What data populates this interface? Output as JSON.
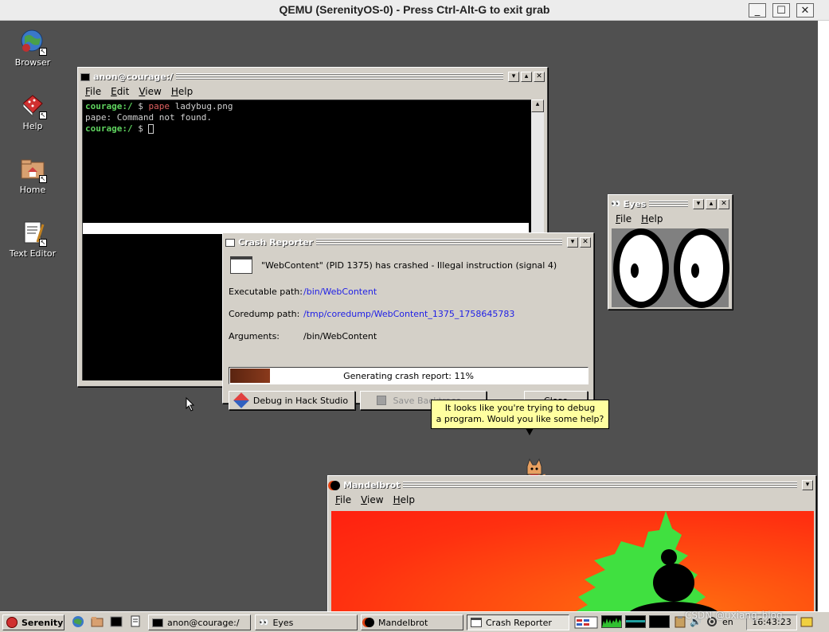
{
  "qemu": {
    "title": "QEMU (SerenityOS-0) - Press Ctrl-Alt-G to exit grab",
    "minimize_glyph": "_",
    "maximize_glyph": "☐",
    "close_glyph": "✕"
  },
  "desktop_icons": [
    {
      "label": "Browser",
      "icon": "globe-icon"
    },
    {
      "label": "Help",
      "icon": "help-book-icon"
    },
    {
      "label": "Home",
      "icon": "home-folder-icon"
    },
    {
      "label": "Text Editor",
      "icon": "text-editor-icon"
    }
  ],
  "terminal": {
    "title": "anon@courage:/",
    "menu": [
      "File",
      "Edit",
      "View",
      "Help"
    ],
    "lines": [
      {
        "prompt": "courage:/",
        "dollar": " $ ",
        "cmd": "pape",
        "rest": " ladybug.png"
      },
      {
        "text": "pape: Command not found."
      },
      {
        "prompt": "courage:/",
        "dollar": " $ "
      }
    ]
  },
  "crash_reporter": {
    "title": "Crash Reporter",
    "headline": "\"WebContent\" (PID 1375) has crashed - Illegal instruction (signal 4)",
    "executable_label": "Executable path:",
    "executable_value": "/bin/WebContent",
    "coredump_label": "Coredump path:",
    "coredump_value": "/tmp/coredump/WebContent_1375_1758645783",
    "arguments_label": "Arguments:",
    "arguments_value": "/bin/WebContent",
    "progress_text": "Generating crash report: 11%",
    "progress_fraction": 0.11,
    "debug_button": "Debug in Hack Studio",
    "save_button": "Save Backtrace...",
    "close_button": "Close"
  },
  "eyes": {
    "title": "Eyes",
    "menu": [
      "File",
      "Help"
    ]
  },
  "assistant": {
    "line1": "It looks like you're trying to debug",
    "line2": "a program. Would you like some help?"
  },
  "mandelbrot": {
    "title": "Mandelbrot",
    "menu": [
      "File",
      "View",
      "Help"
    ]
  },
  "taskbar": {
    "start_label": "Serenity",
    "quick_launch": [
      "browser-icon",
      "file-manager-icon",
      "terminal-icon",
      "text-editor-icon"
    ],
    "windows": [
      {
        "label": "anon@courage:/",
        "icon": "terminal-icon"
      },
      {
        "label": "Eyes",
        "icon": "eyes-icon"
      },
      {
        "label": "Mandelbrot",
        "icon": "mandelbrot-icon"
      },
      {
        "label": "Crash Reporter",
        "icon": "crash-reporter-icon"
      }
    ],
    "keymap": "en",
    "clock": "16:43:23",
    "watermark": "CSDN @uxiang_blog"
  },
  "colors": {
    "desktop": "#505050",
    "terminal_prompt": "#5fd35f",
    "link": "#1e1ee6",
    "progress_fill": "#6a2a14",
    "balloon": "#ffffa0"
  }
}
